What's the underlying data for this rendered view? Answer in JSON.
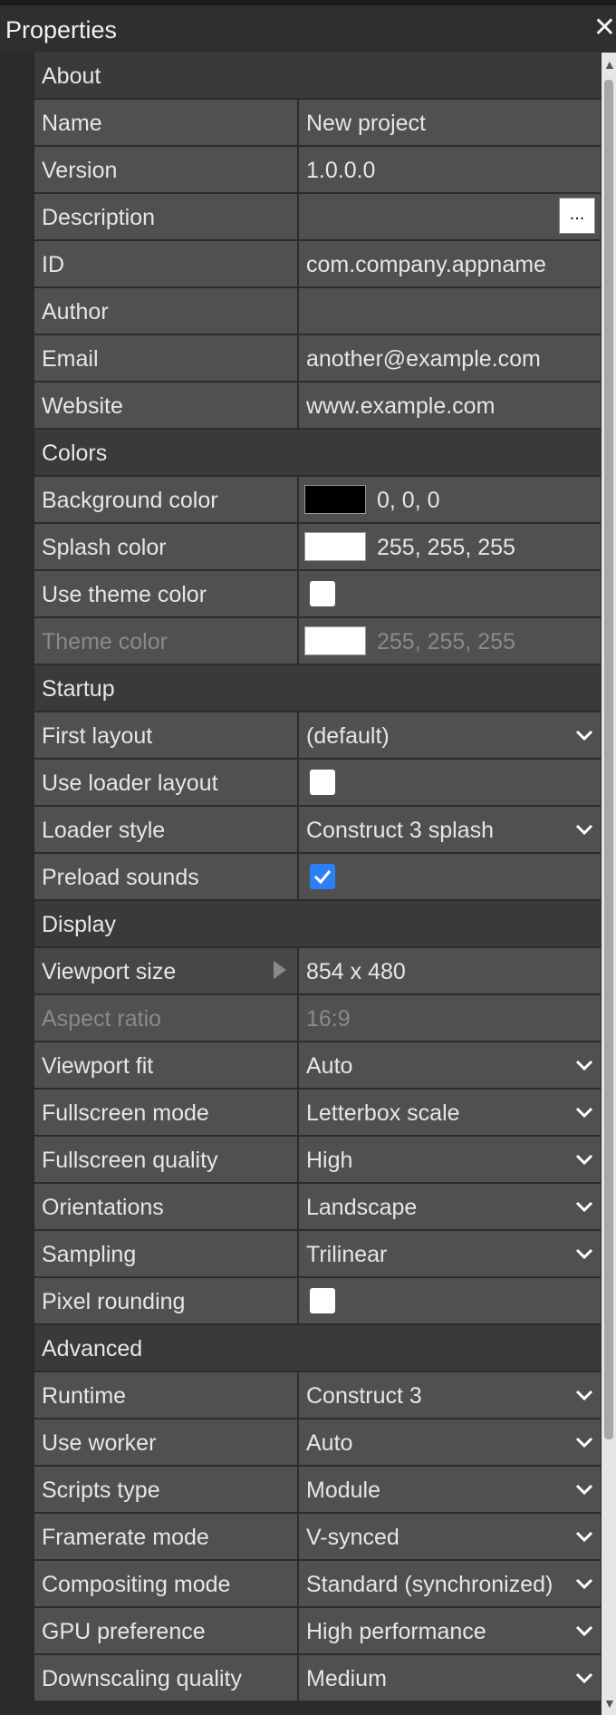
{
  "panel": {
    "title": "Properties",
    "close_label": "✕"
  },
  "sections": [
    {
      "title": "About",
      "rows": [
        {
          "name": "Name",
          "type": "text",
          "value": "New project"
        },
        {
          "name": "Version",
          "type": "text",
          "value": "1.0.0.0"
        },
        {
          "name": "Description",
          "type": "ellipsis",
          "value": "",
          "button_label": "..."
        },
        {
          "name": "ID",
          "type": "text",
          "value": "com.company.appname"
        },
        {
          "name": "Author",
          "type": "text",
          "value": ""
        },
        {
          "name": "Email",
          "type": "text",
          "value": "another@example.com"
        },
        {
          "name": "Website",
          "type": "text",
          "value": "www.example.com"
        }
      ]
    },
    {
      "title": "Colors",
      "rows": [
        {
          "name": "Background color",
          "type": "color",
          "color": "#000000",
          "value": "0, 0, 0"
        },
        {
          "name": "Splash color",
          "type": "color",
          "color": "#ffffff",
          "value": "255, 255, 255"
        },
        {
          "name": "Use theme color",
          "type": "checkbox",
          "checked": false
        },
        {
          "name": "Theme color",
          "type": "color",
          "color": "#ffffff",
          "value": "255, 255, 255",
          "disabled": true
        }
      ]
    },
    {
      "title": "Startup",
      "rows": [
        {
          "name": "First layout",
          "type": "dropdown",
          "value": "(default)"
        },
        {
          "name": "Use loader layout",
          "type": "checkbox",
          "checked": false
        },
        {
          "name": "Loader style",
          "type": "dropdown",
          "value": "Construct 3 splash"
        },
        {
          "name": "Preload sounds",
          "type": "checkbox",
          "checked": true
        }
      ]
    },
    {
      "title": "Display",
      "rows": [
        {
          "name": "Viewport size",
          "type": "expand",
          "value": "854 x 480",
          "selected": true
        },
        {
          "name": "Aspect ratio",
          "type": "text",
          "value": "16:9",
          "disabled": true
        },
        {
          "name": "Viewport fit",
          "type": "dropdown",
          "value": "Auto"
        },
        {
          "name": "Fullscreen mode",
          "type": "dropdown",
          "value": "Letterbox scale"
        },
        {
          "name": "Fullscreen quality",
          "type": "dropdown",
          "value": "High"
        },
        {
          "name": "Orientations",
          "type": "dropdown",
          "value": "Landscape"
        },
        {
          "name": "Sampling",
          "type": "dropdown",
          "value": "Trilinear"
        },
        {
          "name": "Pixel rounding",
          "type": "checkbox",
          "checked": false
        }
      ]
    },
    {
      "title": "Advanced",
      "rows": [
        {
          "name": "Runtime",
          "type": "dropdown",
          "value": "Construct 3"
        },
        {
          "name": "Use worker",
          "type": "dropdown",
          "value": "Auto"
        },
        {
          "name": "Scripts type",
          "type": "dropdown",
          "value": "Module"
        },
        {
          "name": "Framerate mode",
          "type": "dropdown",
          "value": "V-synced"
        },
        {
          "name": "Compositing mode",
          "type": "dropdown",
          "value": "Standard (synchronized)"
        },
        {
          "name": "GPU preference",
          "type": "dropdown",
          "value": "High performance"
        },
        {
          "name": "Downscaling quality",
          "type": "dropdown",
          "value": "Medium"
        }
      ]
    }
  ],
  "icons": {
    "chevron": "chevron-down-icon",
    "check": "checkmark-icon",
    "expand": "expand-arrow-icon",
    "close": "close-icon"
  },
  "colors": {
    "checkbox_checked": "#2d7ff9",
    "row_bg": "#505050",
    "section_bg": "#3a3a3a"
  }
}
